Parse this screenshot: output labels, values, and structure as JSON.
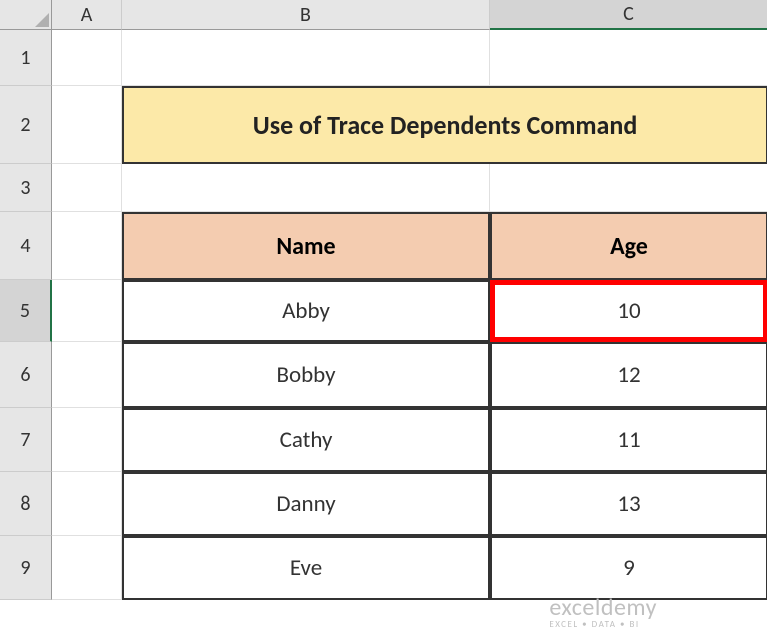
{
  "columns": [
    "A",
    "B",
    "C"
  ],
  "rows": [
    "1",
    "2",
    "3",
    "4",
    "5",
    "6",
    "7",
    "8",
    "9"
  ],
  "selectedColumn": "C",
  "selectedRow": "5",
  "title": "Use of Trace Dependents Command",
  "table": {
    "headers": [
      "Name",
      "Age"
    ],
    "rows": [
      {
        "name": "Abby",
        "age": "10"
      },
      {
        "name": "Bobby",
        "age": "12"
      },
      {
        "name": "Cathy",
        "age": "11"
      },
      {
        "name": "Danny",
        "age": "13"
      },
      {
        "name": "Eve",
        "age": "9"
      }
    ]
  },
  "watermark": {
    "main": "exceldemy",
    "sub": "EXCEL • DATA • BI"
  }
}
